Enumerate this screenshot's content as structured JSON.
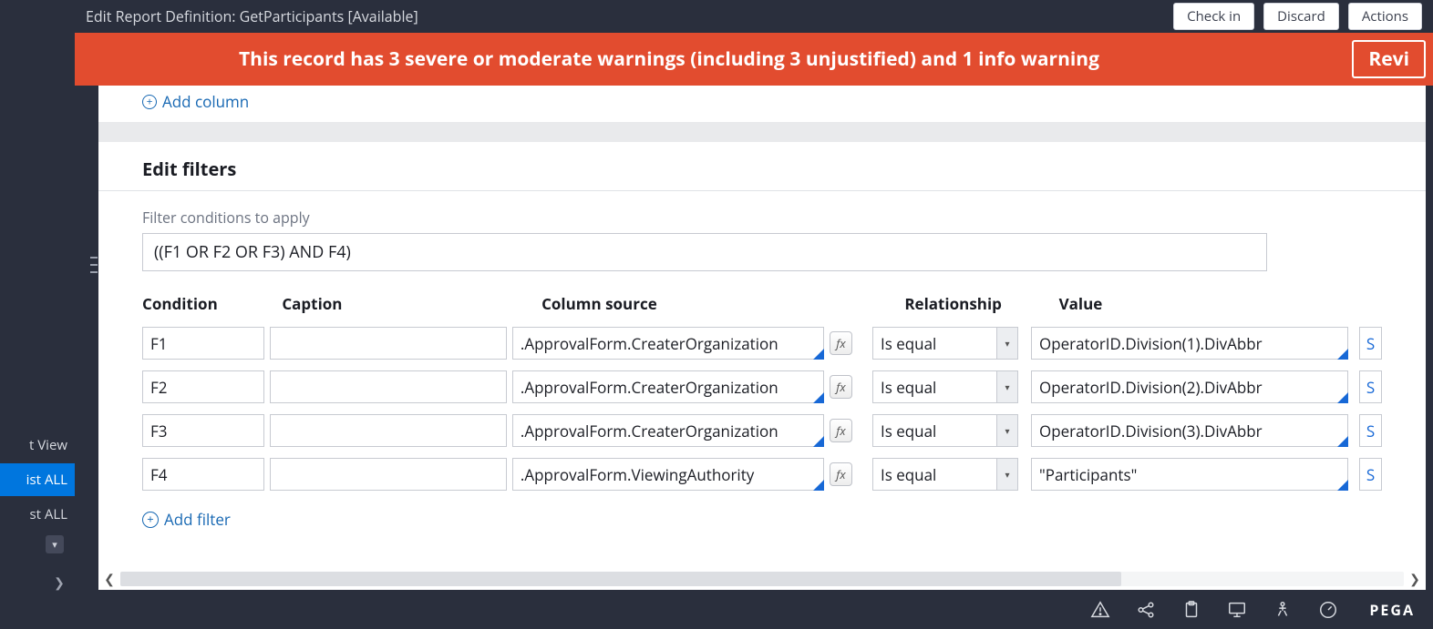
{
  "header": {
    "title": "Edit  Report Definition: GetParticipants [Available]",
    "buttons": {
      "checkin": "Check in",
      "discard": "Discard",
      "actions": "Actions"
    }
  },
  "banner": {
    "text": "This record has 3 severe or moderate warnings (including 3 unjustified) and 1 info warning",
    "review": "Revi"
  },
  "addColumn": {
    "label": "Add column"
  },
  "sidebar": {
    "view": "t View",
    "listall": "ist ALL",
    "stall": "st ALL"
  },
  "filters": {
    "heading": "Edit filters",
    "conditionsLabel": "Filter conditions to apply",
    "expression": "((F1 OR F2 OR F3) AND F4)",
    "columns": {
      "condition": "Condition",
      "caption": "Caption",
      "source": "Column source",
      "relationship": "Relationship",
      "value": "Value"
    },
    "rows": [
      {
        "cond": "F1",
        "cap": "",
        "src": ".ApprovalForm.CreaterOrganization",
        "rel": "Is equal",
        "val": "OperatorID.Division(1).DivAbbr",
        "s": "S"
      },
      {
        "cond": "F2",
        "cap": "",
        "src": ".ApprovalForm.CreaterOrganization",
        "rel": "Is equal",
        "val": "OperatorID.Division(2).DivAbbr",
        "s": "S"
      },
      {
        "cond": "F3",
        "cap": "",
        "src": ".ApprovalForm.CreaterOrganization",
        "rel": "Is equal",
        "val": "OperatorID.Division(3).DivAbbr",
        "s": "S"
      },
      {
        "cond": "F4",
        "cap": "",
        "src": ".ApprovalForm.ViewingAuthority",
        "rel": "Is equal",
        "val": "\"Participants\"",
        "s": "S"
      }
    ],
    "addFilter": "Add filter"
  },
  "footer": {
    "brand": "PEGA"
  }
}
